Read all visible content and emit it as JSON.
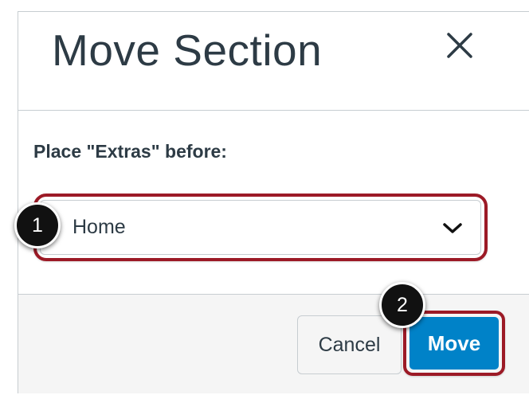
{
  "dialog": {
    "title": "Move Section",
    "close_icon": "close-icon",
    "field_label": "Place \"Extras\" before:",
    "select": {
      "value": "Home",
      "icon": "chevron-down-icon"
    },
    "buttons": {
      "cancel_label": "Cancel",
      "move_label": "Move"
    }
  },
  "callouts": {
    "step_1": "1",
    "step_2": "2",
    "highlight_color": "#9c1a26"
  },
  "colors": {
    "primary_button": "#0082c8",
    "text": "#2d3b45",
    "border": "#c7cdd1",
    "footer_bg": "#f5f5f5"
  }
}
